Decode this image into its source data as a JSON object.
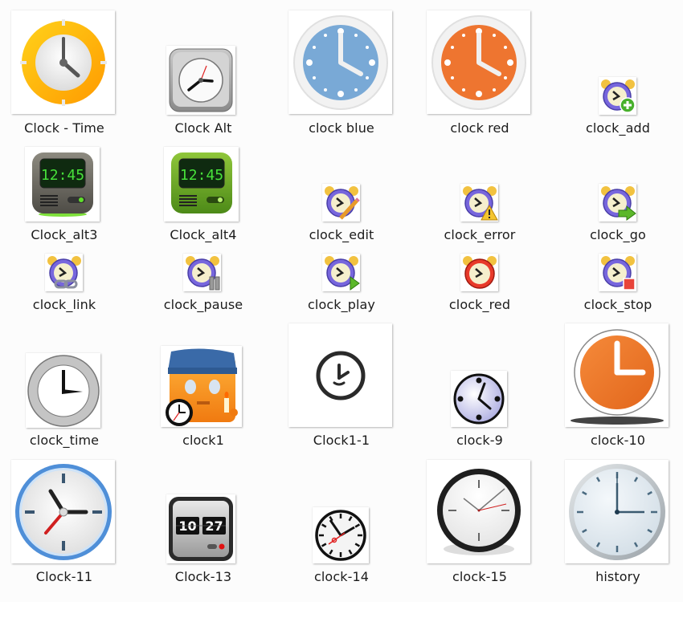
{
  "view": "file-explorer-large-icons",
  "background": "#fcfcfc",
  "items": [
    {
      "name": "Clock - Time",
      "icon": "orange-ring-clock-icon"
    },
    {
      "name": "Clock Alt",
      "icon": "gray-square-clock-icon"
    },
    {
      "name": "clock blue",
      "icon": "blue-clock-icon"
    },
    {
      "name": "clock red",
      "icon": "orange-clock-icon"
    },
    {
      "name": "clock_add",
      "icon": "alarm-clock-add-icon"
    },
    {
      "name": "Clock_alt3",
      "icon": "digital-clock-gray-icon",
      "display": "12:45"
    },
    {
      "name": "Clock_alt4",
      "icon": "digital-clock-green-icon",
      "display": "12:45"
    },
    {
      "name": "clock_edit",
      "icon": "alarm-clock-edit-icon"
    },
    {
      "name": "clock_error",
      "icon": "alarm-clock-error-icon"
    },
    {
      "name": "clock_go",
      "icon": "alarm-clock-go-icon"
    },
    {
      "name": "clock_link",
      "icon": "alarm-clock-link-icon"
    },
    {
      "name": "clock_pause",
      "icon": "alarm-clock-pause-icon"
    },
    {
      "name": "clock_play",
      "icon": "alarm-clock-play-icon"
    },
    {
      "name": "clock_red",
      "icon": "alarm-clock-red-icon"
    },
    {
      "name": "clock_stop",
      "icon": "alarm-clock-stop-icon"
    },
    {
      "name": "clock_time",
      "icon": "silver-ring-clock-icon"
    },
    {
      "name": "clock1",
      "icon": "sleepy-character-clock-icon"
    },
    {
      "name": "Clock1-1",
      "icon": "outline-clock-icon"
    },
    {
      "name": "clock-9",
      "icon": "lavender-clock-icon"
    },
    {
      "name": "clock-10",
      "icon": "orange-flat-clock-icon"
    },
    {
      "name": "Clock-11",
      "icon": "blue-rim-clock-icon"
    },
    {
      "name": "Clock-13",
      "icon": "flip-clock-icon",
      "display": [
        "10",
        "27"
      ]
    },
    {
      "name": "clock-14",
      "icon": "station-clock-icon"
    },
    {
      "name": "clock-15",
      "icon": "black-rim-clock-icon"
    },
    {
      "name": "history",
      "icon": "silver-history-clock-icon"
    }
  ]
}
